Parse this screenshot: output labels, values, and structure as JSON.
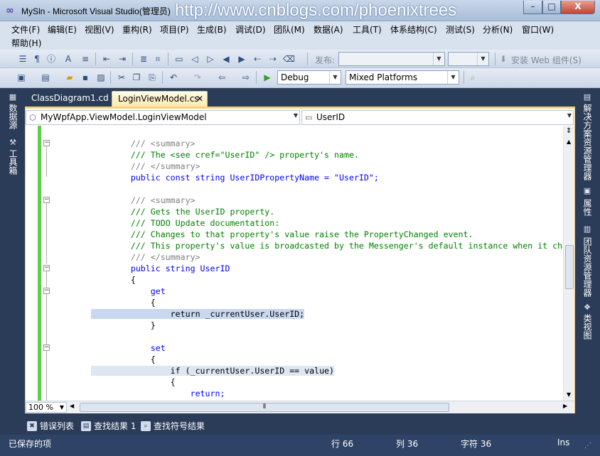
{
  "window": {
    "title": "MySln - Microsoft Visual Studio(管理员)",
    "watermark": "http://www.cnblogs.com/phoenixtrees",
    "min": "–",
    "max": "□",
    "close": "X"
  },
  "menu": [
    "文件(F)",
    "编辑(E)",
    "视图(V)",
    "重构(R)",
    "项目(P)",
    "生成(B)",
    "调试(D)",
    "团队(M)",
    "数据(A)",
    "工具(T)",
    "体系结构(C)",
    "测试(S)",
    "分析(N)",
    "窗口(W)",
    "帮助(H)"
  ],
  "toolbar1": {
    "publish_label": "发布:",
    "install_web": "安装 Web 组件(S)"
  },
  "toolbar2": {
    "config": "Debug",
    "platform": "Mixed Platforms"
  },
  "left_strip": [
    "数据源",
    "工具箱"
  ],
  "right_strip": [
    "解决方案资源管理器",
    "属性",
    "团队资源管理器",
    "类视图"
  ],
  "tabs": [
    {
      "label": "ClassDiagram1.cd"
    },
    {
      "label": "LoginViewModel.cs",
      "close": "✕"
    }
  ],
  "nav": {
    "type": "MyWpfApp.ViewModel.LoginViewModel",
    "member": "UserID"
  },
  "code": [
    "        /// <summary>",
    "        /// The <see cref=\"UserID\" /> property's name.",
    "        /// </summary>",
    "        public const string UserIDPropertyName = \"UserID\";",
    "",
    "        /// <summary>",
    "        /// Gets the UserID property.",
    "        /// TODO Update documentation:",
    "        /// Changes to that property's value raise the PropertyChanged event.",
    "        /// This property's value is broadcasted by the Messenger's default instance when it changes.",
    "        /// </summary>",
    "        public string UserID",
    "        {",
    "            get",
    "            {",
    "                return _currentUser.UserID;",
    "            }",
    "",
    "            set",
    "            {",
    "                if (_currentUser.UserID == value)",
    "                {",
    "                    return;",
    "                }"
  ],
  "editor": {
    "zoom": "100 %"
  },
  "bottom_tabs": [
    "错误列表",
    "查找结果 1",
    "查找符号结果"
  ],
  "status": {
    "message": "已保存的项",
    "line": "行 66",
    "col": "列 36",
    "char": "字符 36",
    "mode": "Ins"
  }
}
